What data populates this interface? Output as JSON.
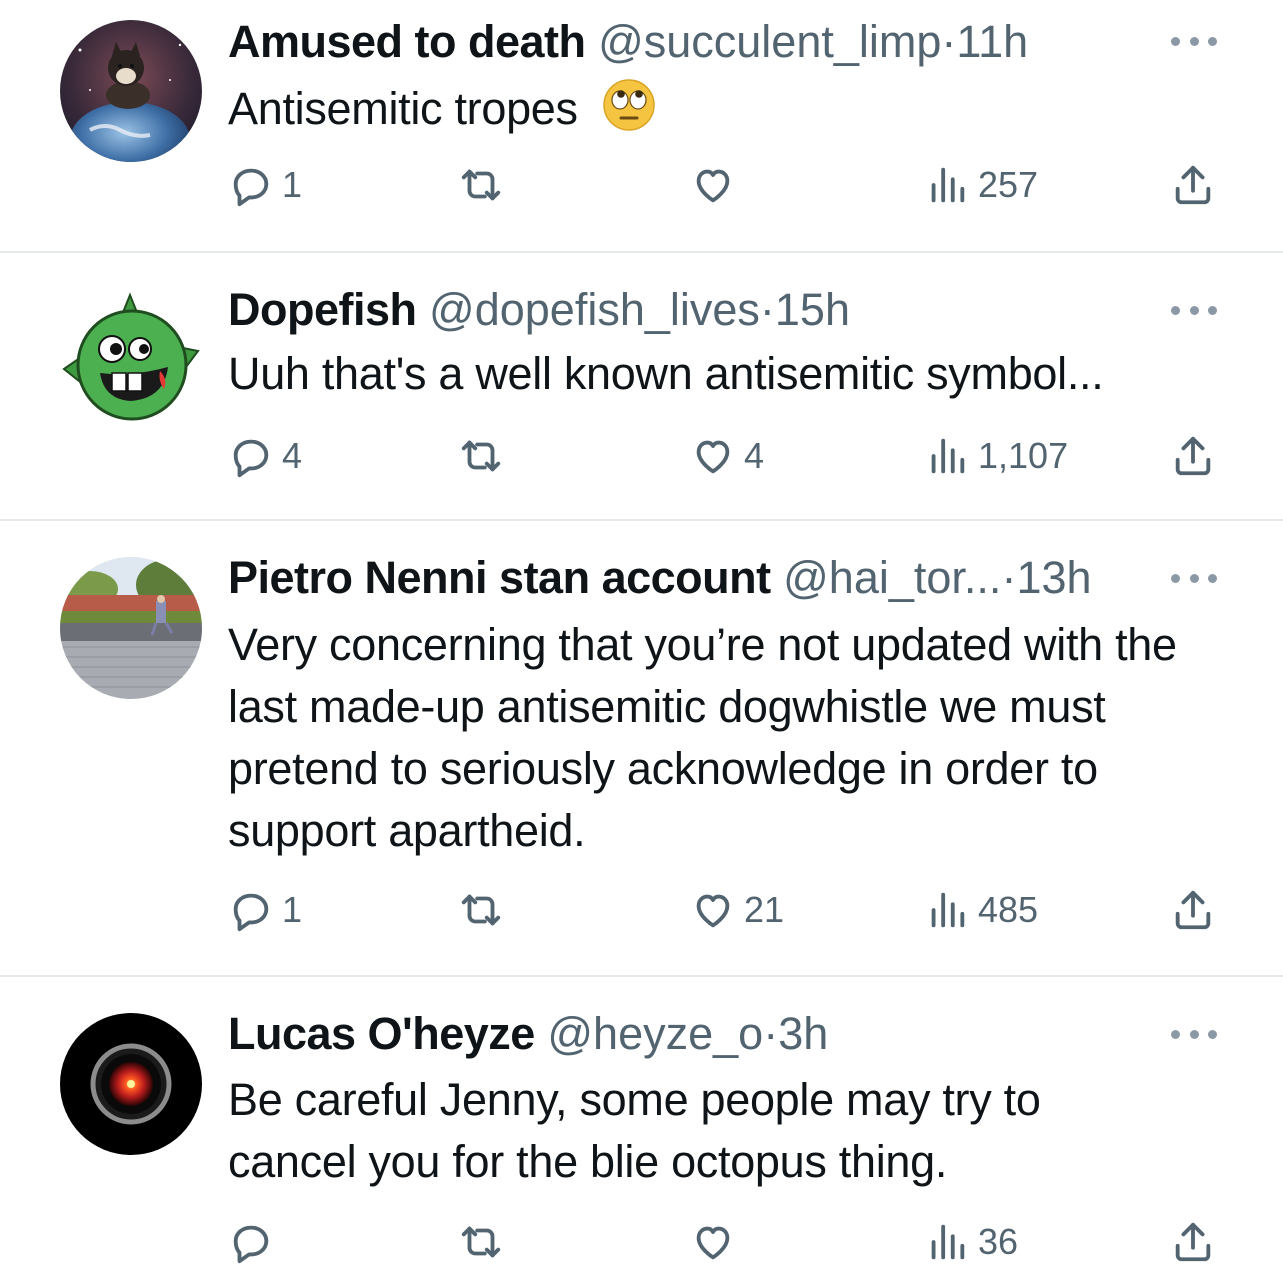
{
  "tweets": [
    {
      "name": "Amused to death",
      "handle": "@succulent_limp",
      "time": "11h",
      "text": "Antisemitic tropes",
      "emoji": "eye-roll-emoji",
      "avatar": "shiba-on-globe-avatar",
      "replies": "1",
      "retweets": "",
      "likes": "",
      "views": "257"
    },
    {
      "name": "Dopefish",
      "handle": "@dopefish_lives",
      "time": "15h",
      "text": "Uuh that's a well known antisemitic symbol...",
      "avatar": "green-dopefish-avatar",
      "replies": "4",
      "retweets": "",
      "likes": "4",
      "views": "1,107"
    },
    {
      "name": "Pietro Nenni stan account",
      "handle": "@hai_tor...",
      "time": "13h",
      "text": "Very concerning that you’re not updated with the last made-up antisemitic dogwhistle we must pretend to seriously acknowledge in order to support apartheid.",
      "avatar": "park-photo-avatar",
      "replies": "1",
      "retweets": "",
      "likes": "21",
      "views": "485"
    },
    {
      "name": "Lucas O'heyze",
      "handle": "@heyze_o",
      "time": "3h",
      "text": "Be careful Jenny, some people may try to cancel you for the blie octopus thing.",
      "avatar": "hal9000-eye-avatar",
      "replies": "",
      "retweets": "",
      "likes": "",
      "views": "36"
    }
  ],
  "separator": "·",
  "icons": {
    "reply": "reply-icon",
    "retweet": "retweet-icon",
    "like": "heart-icon",
    "views": "views-chart-icon",
    "share": "share-icon",
    "more": "more-dots-icon"
  },
  "colors": {
    "text": "#0f1419",
    "meta": "#536471",
    "divider": "#e6e9ec",
    "dopefish_green": "#4caf50",
    "hal_red": "#e53935"
  }
}
